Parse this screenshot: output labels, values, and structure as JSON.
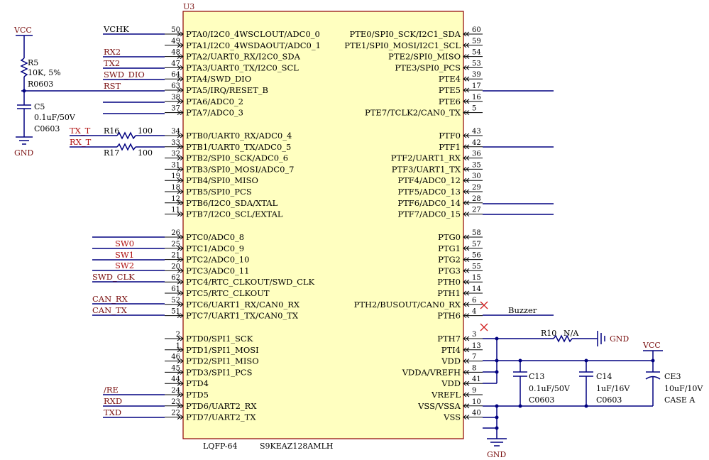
{
  "chip": {
    "ref": "U3",
    "package": "LQFP-64",
    "part": "S9KEAZ128AMLH",
    "left_pins": [
      {
        "num": "50",
        "name": "PTA0/I2C0_4WSCLOUT/ADC0_0"
      },
      {
        "num": "49",
        "name": "PTA1/I2C0_4WSDAOUT/ADC0_1"
      },
      {
        "num": "48",
        "name": "PTA2/UART0_RX/I2C0_SDA"
      },
      {
        "num": "47",
        "name": "PTA3/UART0_TX/I2C0_SCL"
      },
      {
        "num": "64",
        "name": "PTA4/SWD_DIO"
      },
      {
        "num": "63",
        "name": "PTA5/IRQ/RESET_B"
      },
      {
        "num": "38",
        "name": "PTA6/ADC0_2"
      },
      {
        "num": "37",
        "name": "PTA7/ADC0_3"
      },
      {
        "num": "34",
        "name": "PTB0/UART0_RX/ADC0_4"
      },
      {
        "num": "33",
        "name": "PTB1/UART0_TX/ADC0_5"
      },
      {
        "num": "32",
        "name": "PTB2/SPI0_SCK/ADC0_6"
      },
      {
        "num": "31",
        "name": "PTB3/SPI0_MOSI/ADC0_7"
      },
      {
        "num": "19",
        "name": "PTB4/SPI0_MISO"
      },
      {
        "num": "18",
        "name": "PTB5/SPI0_PCS"
      },
      {
        "num": "12",
        "name": "PTB6/I2C0_SDA/XTAL"
      },
      {
        "num": "11",
        "name": "PTB7/I2C0_SCL/EXTAL"
      },
      {
        "num": "26",
        "name": "PTC0/ADC0_8"
      },
      {
        "num": "25",
        "name": "PTC1/ADC0_9"
      },
      {
        "num": "21",
        "name": "PTC2/ADC0_10"
      },
      {
        "num": "20",
        "name": "PTC3/ADC0_11"
      },
      {
        "num": "62",
        "name": "PTC4/RTC_CLKOUT/SWD_CLK"
      },
      {
        "num": "61",
        "name": "PTC5/RTC_CLKOUT"
      },
      {
        "num": "52",
        "name": "PTC6/UART1_RX/CAN0_RX"
      },
      {
        "num": "51",
        "name": "PTC7/UART1_TX/CAN0_TX"
      },
      {
        "num": "2",
        "name": "PTD0/SPI1_SCK"
      },
      {
        "num": "1",
        "name": "PTD1/SPI1_MOSI"
      },
      {
        "num": "46",
        "name": "PTD2/SPI1_MISO"
      },
      {
        "num": "45",
        "name": "PTD3/SPI1_PCS"
      },
      {
        "num": "44",
        "name": "PTD4"
      },
      {
        "num": "24",
        "name": "PTD5"
      },
      {
        "num": "23",
        "name": "PTD6/UART2_RX"
      },
      {
        "num": "22",
        "name": "PTD7/UART2_TX"
      }
    ],
    "right_pins": [
      {
        "num": "60",
        "name": "PTE0/SPI0_SCK/I2C1_SDA"
      },
      {
        "num": "59",
        "name": "PTE1/SPI0_MOSI/I2C1_SCL"
      },
      {
        "num": "54",
        "name": "PTE2/SPI0_MISO"
      },
      {
        "num": "53",
        "name": "PTE3/SPI0_PCS"
      },
      {
        "num": "39",
        "name": "PTE4"
      },
      {
        "num": "17",
        "name": "PTE5"
      },
      {
        "num": "16",
        "name": "PTE6"
      },
      {
        "num": "5",
        "name": "PTE7/TCLK2/CAN0_TX"
      },
      {
        "num": "43",
        "name": "PTF0"
      },
      {
        "num": "42",
        "name": "PTF1"
      },
      {
        "num": "36",
        "name": "PTF2/UART1_RX"
      },
      {
        "num": "35",
        "name": "PTF3/UART1_TX"
      },
      {
        "num": "30",
        "name": "PTF4/ADC0_12"
      },
      {
        "num": "29",
        "name": "PTF5/ADC0_13"
      },
      {
        "num": "28",
        "name": "PTF6/ADC0_14"
      },
      {
        "num": "27",
        "name": "PTF7/ADC0_15"
      },
      {
        "num": "58",
        "name": "PTG0"
      },
      {
        "num": "57",
        "name": "PTG1"
      },
      {
        "num": "56",
        "name": "PTG2"
      },
      {
        "num": "55",
        "name": "PTG3"
      },
      {
        "num": "15",
        "name": "PTH0"
      },
      {
        "num": "14",
        "name": "PTH1"
      },
      {
        "num": "6",
        "name": "PTH2/BUSOUT/CAN0_RX"
      },
      {
        "num": "4",
        "name": "PTH6"
      },
      {
        "num": "3",
        "name": "PTH7"
      },
      {
        "num": "13",
        "name": "PTI4"
      },
      {
        "num": "7",
        "name": "VDD"
      },
      {
        "num": "8",
        "name": "VDDA/VREFH"
      },
      {
        "num": "41",
        "name": "VDD"
      },
      {
        "num": "9",
        "name": "VREFL"
      },
      {
        "num": "10",
        "name": "VSS/VSSA"
      },
      {
        "num": "40",
        "name": "VSS"
      }
    ]
  },
  "nets": {
    "vchk": "VCHK",
    "rx2": "RX2",
    "tx2": "TX2",
    "swd_dio": "SWD_DIO",
    "rst": "RST",
    "tx_t": "TX_T",
    "rx_t": "RX_T",
    "sw0": "SW0",
    "sw1": "SW1",
    "sw2": "SW2",
    "swd_clk": "SWD_CLK",
    "can_rx": "CAN_RX",
    "can_tx": "CAN_TX",
    "re": "/RE",
    "rxd": "RXD",
    "txd": "TXD",
    "buzzer": "Buzzer"
  },
  "power": {
    "vcc": "VCC",
    "gnd": "GND"
  },
  "components": {
    "r5": {
      "ref": "R5",
      "value": "10K, 5%",
      "footprint": "R0603"
    },
    "c5": {
      "ref": "C5",
      "value": "0.1uF/50V",
      "footprint": "C0603"
    },
    "r16": {
      "ref": "R16",
      "value": "100"
    },
    "r17": {
      "ref": "R17",
      "value": "100"
    },
    "r10": {
      "ref": "R10",
      "value": "N/A"
    },
    "c13": {
      "ref": "C13",
      "value": "0.1uF/50V",
      "footprint": "C0603"
    },
    "c14": {
      "ref": "C14",
      "value": "1uF/16V",
      "footprint": "C0603"
    },
    "ce3": {
      "ref": "CE3",
      "value": "10uF/10V",
      "footprint": "CASE A"
    }
  }
}
